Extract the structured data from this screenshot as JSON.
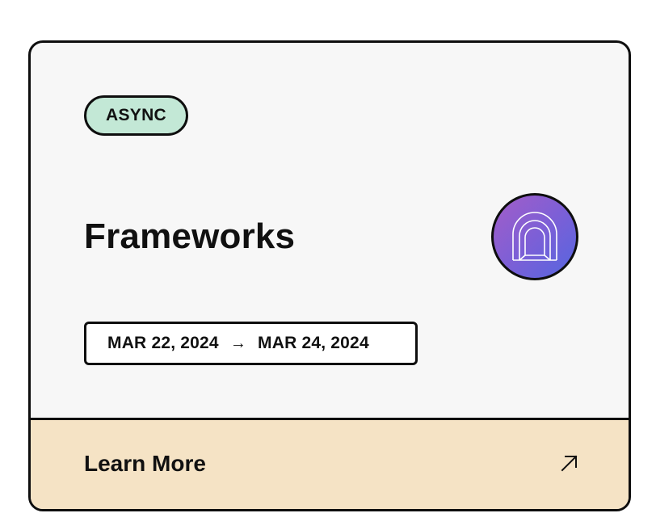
{
  "card": {
    "tag": "ASYNC",
    "title": "Frameworks",
    "logo_icon": "tunnel-arch-icon",
    "date_start": "MAR 22, 2024",
    "date_arrow": "→",
    "date_end": "MAR 24, 2024",
    "cta_label": "Learn More",
    "cta_icon": "external-arrow-icon"
  },
  "colors": {
    "tag_bg": "#c3e8d6",
    "card_bg": "#f7f7f7",
    "footer_bg": "#f5e3c5",
    "logo_gradient_start": "#a35ec8",
    "logo_gradient_end": "#5566e0",
    "border": "#0e0e0e"
  }
}
